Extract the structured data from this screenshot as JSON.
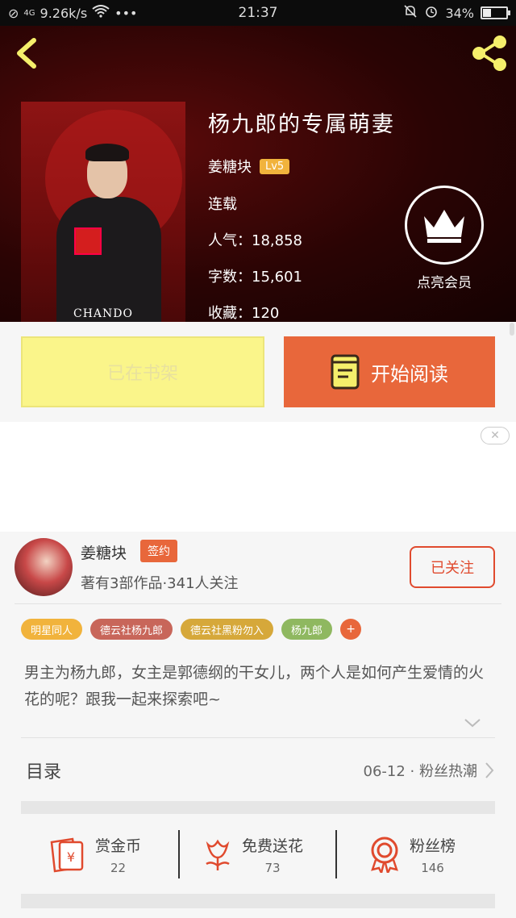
{
  "status_bar": {
    "network": "4G",
    "speed": "9.26k/s",
    "dots": "•••",
    "time": "21:37",
    "battery": "34%",
    "battery_level": 0.34
  },
  "book": {
    "title": "杨九郎的专属萌妻",
    "author": "姜糖块",
    "level": "Lv5",
    "status": "连载",
    "popularity": "人气：18,858",
    "word_count": "字数：15,601",
    "favorites": "收藏：120",
    "cover_brand": "CHANDO"
  },
  "vip": {
    "label": "点亮会员"
  },
  "buttons": {
    "shelf_label": "已在书架",
    "read_label": "开始阅读"
  },
  "ad": {
    "close_icon": "✕"
  },
  "author_card": {
    "name": "姜糖块",
    "badge": "签约",
    "stats": "著有3部作品·341人关注",
    "follow_label": "已关注"
  },
  "tags": [
    {
      "label": "明星同人",
      "color": "#f1b33c"
    },
    {
      "label": "德云社杨九郎",
      "color": "#c8665a"
    },
    {
      "label": "德云社黑粉勿入",
      "color": "#d6a83a"
    },
    {
      "label": "杨九郎",
      "color": "#8fb860"
    },
    {
      "label": "+",
      "color": "#e8673b"
    }
  ],
  "description": "男主为杨九郎，女主是郭德纲的干女儿，两个人是如何产生爱情的火花的呢？跟我一起来探索吧~",
  "toc": {
    "label": "目录",
    "update": "06-12 · 粉丝热潮"
  },
  "actions": [
    {
      "name": "赏金币",
      "count": "22",
      "icon": "coin-envelope-icon"
    },
    {
      "name": "免费送花",
      "count": "73",
      "icon": "flower-icon"
    },
    {
      "name": "粉丝榜",
      "count": "146",
      "icon": "medal-icon"
    }
  ],
  "colors": {
    "accent": "#e8673b",
    "follow": "#e04a2e",
    "shelf": "#faf58a"
  }
}
